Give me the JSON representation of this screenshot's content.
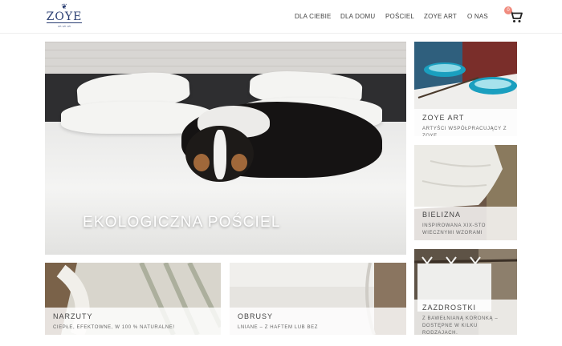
{
  "header": {
    "logo_text": "ZOYE",
    "nav": [
      {
        "label": "DLA CIEBIE"
      },
      {
        "label": "DLA DOMU"
      },
      {
        "label": "POŚCIEL"
      },
      {
        "label": "ZOYE ART"
      },
      {
        "label": "O NAS"
      }
    ],
    "cart_count": "0",
    "cart_icon": "cart-icon"
  },
  "hero": {
    "title": "EKOLOGICZNA POŚCIEL"
  },
  "tiles": {
    "zoye_art": {
      "title": "ZOYE ART",
      "subtitle": "ARTYŚCI WSPÓŁPRACUJĄCY Z ZOYE"
    },
    "bielizna": {
      "title": "BIELIZNA",
      "subtitle": "INSPIROWANA XIX-STO WIECZNYMI WZORAMI"
    },
    "zazdrostki": {
      "title": "ZAZDROSTKI",
      "subtitle": "Z BAWEŁNIANĄ KORONKĄ – DOSTĘPNE W KILKU RODZAJACH."
    },
    "narzuty": {
      "title": "NARZUTY",
      "subtitle": "CIEPŁE, EFEKTOWNE, W 100 % NATURALNE!"
    },
    "obrusy": {
      "title": "OBRUSY",
      "subtitle": "LNIANE – Z HAFTEM LUB BEZ"
    }
  },
  "colors": {
    "brand": "#2b3f73",
    "badge": "#f08b7e"
  }
}
